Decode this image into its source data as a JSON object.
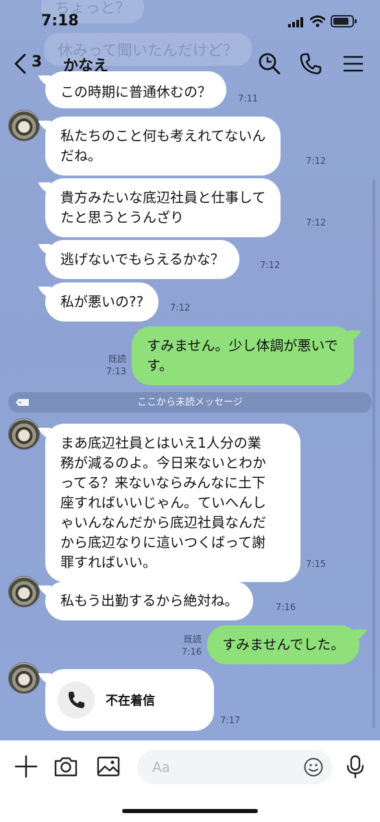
{
  "status": {
    "time": "7:18"
  },
  "header": {
    "back_count": "3",
    "title": "かなえ"
  },
  "ghost_messages": [
    "ちょっと？",
    "休みって聞いたんだけど？"
  ],
  "messages": [
    {
      "text": "この時期に普通休むの？",
      "time": "7:11"
    },
    {
      "text": "私たちのこと何も考えれてないん\nだね。",
      "time": "7:12"
    },
    {
      "text": "貴方みたいな底辺社員と仕事して\nたと思うとうんざり",
      "time": "7:12"
    },
    {
      "text": "逃げないでもらえるかな？",
      "time": "7:12"
    },
    {
      "text": "私が悪いの??",
      "time": "7:12"
    },
    {
      "text": "すみません。少し体調が悪いで\nす。",
      "time": "7:13",
      "read": "既読"
    },
    {
      "text": "まあ底辺社員とはいえ1人分の業\n務が減るのよ。今日来ないとわか\nってる？来ないならみんなに土下\n座すればいいじゃん。ていへんし\nゃいんなんだから底辺社員なんだ\nから底辺なりに這いつくばって謝\n罪すればいい。",
      "time": "7:15"
    },
    {
      "text": "私もう出勤するから絶対ね。",
      "time": "7:16"
    },
    {
      "text": "すみませんでした。",
      "time": "7:16",
      "read": "既読"
    }
  ],
  "divider": {
    "label": "ここから未読メッセージ"
  },
  "missed_call": {
    "label": "不在着信",
    "time": "7:17"
  },
  "input": {
    "placeholder": "Aa"
  },
  "colors": {
    "background": "#8fa4d4",
    "outgoing_bubble": "#8fe07a",
    "incoming_bubble": "#ffffff"
  }
}
